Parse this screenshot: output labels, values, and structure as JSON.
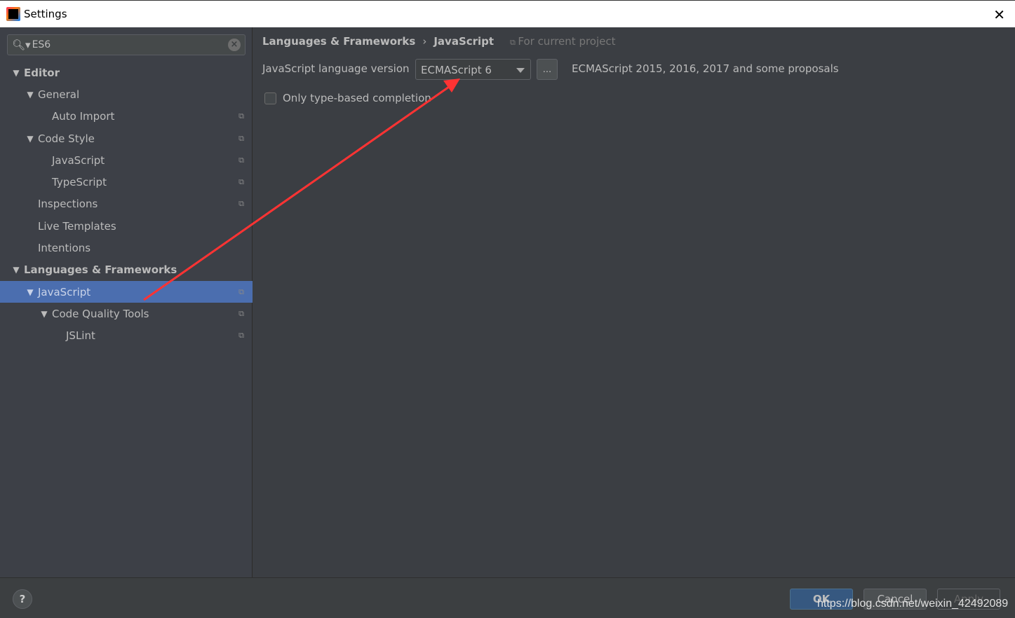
{
  "window": {
    "title": "Settings",
    "close": "✕"
  },
  "search": {
    "value": "ES6",
    "icon": "search-icon"
  },
  "tree": [
    {
      "label": "Editor",
      "level": 0,
      "expanded": true,
      "bold": true,
      "project": false
    },
    {
      "label": "General",
      "level": 1,
      "expanded": true,
      "project": false
    },
    {
      "label": "Auto Import",
      "level": 2,
      "project": true
    },
    {
      "label": "Code Style",
      "level": 1,
      "expanded": true,
      "project": true
    },
    {
      "label": "JavaScript",
      "level": 2,
      "project": true
    },
    {
      "label": "TypeScript",
      "level": 2,
      "project": true
    },
    {
      "label": "Inspections",
      "level": 1,
      "project": true
    },
    {
      "label": "Live Templates",
      "level": 1,
      "project": false
    },
    {
      "label": "Intentions",
      "level": 1,
      "project": false
    },
    {
      "label": "Languages & Frameworks",
      "level": 0,
      "expanded": true,
      "bold": true,
      "project": false
    },
    {
      "label": "JavaScript",
      "level": 1,
      "expanded": true,
      "selected": true,
      "project": true
    },
    {
      "label": "Code Quality Tools",
      "level": 2,
      "expanded": true,
      "project": true
    },
    {
      "label": "JSLint",
      "level": 3,
      "project": true
    }
  ],
  "main": {
    "breadcrumb": [
      "Languages & Frameworks",
      "JavaScript"
    ],
    "breadcrumb_sep": "›",
    "scope": "For current project",
    "version_label": "JavaScript language version",
    "version_value": "ECMAScript 6",
    "more_button": "...",
    "version_desc": "ECMAScript 2015, 2016, 2017 and some proposals",
    "checkbox_label": "Only type-based completion",
    "checkbox_checked": false
  },
  "footer": {
    "help": "?",
    "ok": "OK",
    "cancel": "Cancel",
    "apply": "Apply",
    "watermark": "https://blog.csdn.net/weixin_42492089"
  },
  "colors": {
    "selection": "#4b6eaf",
    "annotation_arrow": "#ff3333",
    "ok_button": "#365880"
  }
}
